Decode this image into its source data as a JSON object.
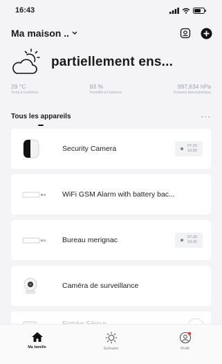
{
  "status_bar": {
    "time": "16:43"
  },
  "header": {
    "home_name": "Ma maison .."
  },
  "weather": {
    "condition": "partiellement ens...",
    "stats": [
      {
        "value": "29 °C",
        "label": "Temp à l'extérieur"
      },
      {
        "value": "83 %",
        "label": "Humidité à l'extérieur"
      },
      {
        "value": "997,634 hPa",
        "label": "Pression Atmosphérique"
      }
    ]
  },
  "tabs": {
    "active": "Tous les appareils",
    "more": "···"
  },
  "devices": [
    {
      "name": "Security Camera",
      "date": "07-22",
      "time": "10:33"
    },
    {
      "name": "WiFi GSM Alarm with battery bac..."
    },
    {
      "name": "Bureau merignac",
      "date": "07-20",
      "time": "10:33"
    },
    {
      "name": "Caméra de surveillance"
    },
    {
      "name": "Entrée Séjour ..."
    }
  ],
  "bottom_nav": [
    {
      "label": "Ma famille"
    },
    {
      "label": "Scénario"
    },
    {
      "label": "Profil"
    }
  ]
}
